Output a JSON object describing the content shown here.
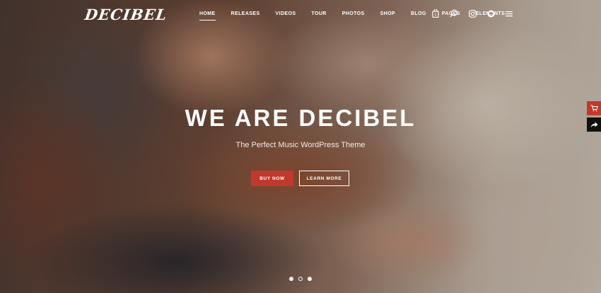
{
  "brand": {
    "logo_text": "DECIBEL"
  },
  "nav": {
    "items": [
      {
        "label": "HOME",
        "active": true
      },
      {
        "label": "RELEASES",
        "active": false
      },
      {
        "label": "VIDEOS",
        "active": false
      },
      {
        "label": "TOUR",
        "active": false
      },
      {
        "label": "PHOTOS",
        "active": false
      },
      {
        "label": "SHOP",
        "active": false
      },
      {
        "label": "BLOG",
        "active": false
      },
      {
        "label": "PAGES",
        "active": false
      },
      {
        "label": "ELEMENTS",
        "active": false
      }
    ],
    "icons": [
      "shopping-bag-icon",
      "search-icon",
      "instagram-icon",
      "spotify-icon",
      "menu-icon"
    ]
  },
  "hero": {
    "title": "WE ARE DECIBEL",
    "subtitle": "The Perfect Music WordPress Theme",
    "buy_label": "BUY NOW",
    "learn_label": "LEARN MORE"
  },
  "slider": {
    "count": 3,
    "active_index": 1
  },
  "side_tabs": [
    "cart-icon",
    "share-icon"
  ],
  "colors": {
    "accent": "#c0392b",
    "text": "#ffffff",
    "share_bg": "#111111"
  }
}
